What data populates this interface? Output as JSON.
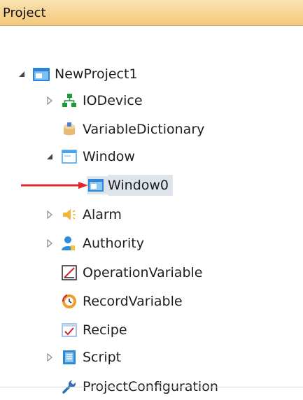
{
  "panel": {
    "title": "Project"
  },
  "tree": {
    "root": {
      "label": "NewProject1",
      "expanded": true,
      "icon": "project-icon"
    },
    "items": [
      {
        "label": "IODevice",
        "icon": "network-icon",
        "expander": "collapsed"
      },
      {
        "label": "VariableDictionary",
        "icon": "database-icon",
        "expander": "none"
      },
      {
        "label": "Window",
        "icon": "window-icon",
        "expander": "expanded",
        "children": [
          {
            "label": "Window0",
            "icon": "window-screen-icon",
            "selected": true
          }
        ]
      },
      {
        "label": "Alarm",
        "icon": "speaker-icon",
        "expander": "collapsed"
      },
      {
        "label": "Authority",
        "icon": "user-icon",
        "expander": "collapsed"
      },
      {
        "label": "OperationVariable",
        "icon": "operation-variable-icon",
        "expander": "none"
      },
      {
        "label": "RecordVariable",
        "icon": "record-icon",
        "expander": "none"
      },
      {
        "label": "Recipe",
        "icon": "recipe-icon",
        "expander": "none"
      },
      {
        "label": "Script",
        "icon": "script-icon",
        "expander": "collapsed"
      },
      {
        "label": "ProjectConfiguration",
        "icon": "wrench-icon",
        "expander": "none"
      }
    ]
  },
  "colors": {
    "header_bg": "#f5cd80",
    "selection_bg": "#dde4ec",
    "annotation_arrow": "#e3262d"
  }
}
